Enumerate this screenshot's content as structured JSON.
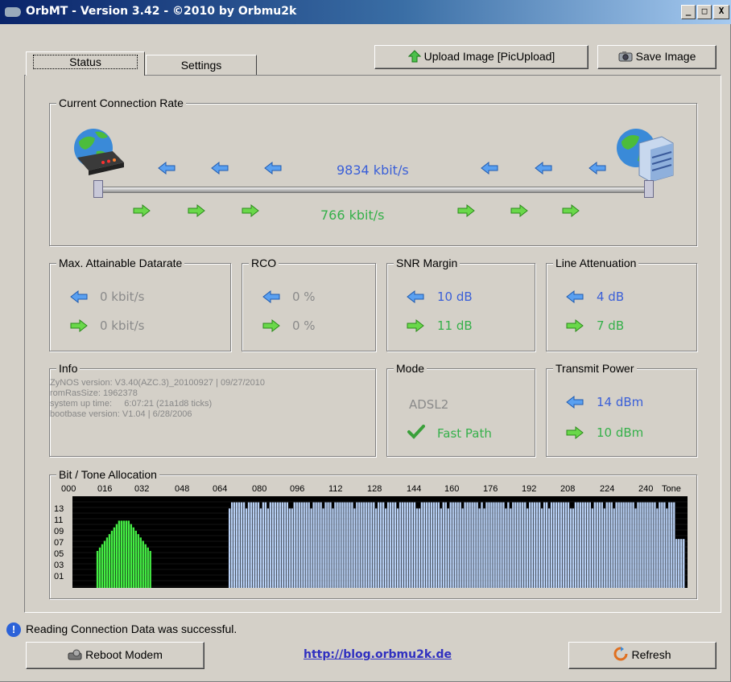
{
  "window": {
    "title": "OrbMT - Version 3.42 - ©2010 by Orbmu2k",
    "controls": [
      "_",
      "□",
      "X"
    ]
  },
  "tabs": [
    {
      "label": "Status",
      "active": true
    },
    {
      "label": "Settings",
      "active": false
    }
  ],
  "toolbar": {
    "upload_label": "Upload Image [PicUpload]",
    "save_label": "Save Image"
  },
  "connection_rate": {
    "legend": "Current Connection Rate",
    "downstream": "9834 kbit/s",
    "upstream": "766 kbit/s"
  },
  "max_attainable": {
    "legend": "Max. Attainable Datarate",
    "down": "0 kbit/s",
    "up": "0 kbit/s"
  },
  "rco": {
    "legend": "RCO",
    "down": "0 %",
    "up": "0 %"
  },
  "snr_margin": {
    "legend": "SNR Margin",
    "down": "10 dB",
    "up": "11 dB"
  },
  "line_attenuation": {
    "legend": "Line Attenuation",
    "down": "4 dB",
    "up": "7 dB"
  },
  "info": {
    "legend": "Info",
    "lines": [
      "ZyNOS version: V3.40(AZC.3)_20100927 | 09/27/2010",
      "romRasSize: 1962378",
      "system up time:     6:07:21 (21a1d8 ticks)",
      "bootbase version: V1.04 | 6/28/2006"
    ]
  },
  "mode": {
    "legend": "Mode",
    "type": "ADSL2",
    "path": "Fast Path"
  },
  "transmit_power": {
    "legend": "Transmit Power",
    "down": "14 dBm",
    "up": "10 dBm"
  },
  "bit_tone": {
    "legend": "Bit / Tone Allocation",
    "x_ticks": [
      "000",
      "016",
      "032",
      "048",
      "064",
      "080",
      "096",
      "112",
      "128",
      "144",
      "160",
      "176",
      "192",
      "208",
      "224",
      "240"
    ],
    "x_unit": "Tone",
    "y_ticks": [
      "13",
      "11",
      "09",
      "07",
      "05",
      "03",
      "01"
    ]
  },
  "status": {
    "message": "Reading Connection Data was successful."
  },
  "footer": {
    "reboot_label": "Reboot Modem",
    "link": "http://blog.orbmu2k.de",
    "refresh_label": "Refresh"
  },
  "colors": {
    "downstream": "#3a5fd8",
    "upstream": "#35b04a",
    "grey_value": "#8a8a8a",
    "chart_down": "#b8d0f4",
    "chart_up": "#44ee44"
  }
}
